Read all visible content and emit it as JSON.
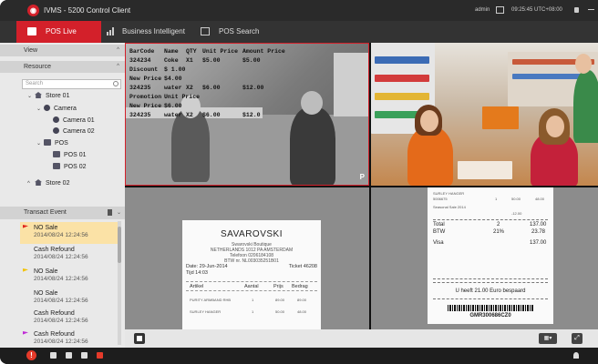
{
  "app": {
    "title": "IVMS - 5200 Control Client",
    "user": "admin",
    "clock": "09:25:45 UTC+08:00"
  },
  "tabs": [
    {
      "label": "POS Live",
      "icon": "pos-icon",
      "active": true
    },
    {
      "label": "Business Intelligent",
      "icon": "bar-chart-icon",
      "active": false
    },
    {
      "label": "POS Search",
      "icon": "pos-search-icon",
      "active": false
    }
  ],
  "sidebar": {
    "view_label": "View",
    "resource_label": "Resource",
    "search_placeholder": "Search",
    "tree": [
      {
        "label": "Store 01",
        "icon": "house-icon",
        "chev": "⌄"
      },
      {
        "label": "Camera",
        "icon": "camera-group-icon",
        "chev": "⌄"
      },
      {
        "label": "Camera 01",
        "icon": "camera-icon",
        "chev": ""
      },
      {
        "label": "Camera 02",
        "icon": "camera-icon",
        "chev": ""
      },
      {
        "label": "POS",
        "icon": "pos-group-icon",
        "chev": "⌄"
      },
      {
        "label": "POS 01",
        "icon": "pos-icon",
        "chev": ""
      },
      {
        "label": "POS 02",
        "icon": "pos-icon",
        "chev": ""
      },
      {
        "label": "Store 02",
        "icon": "house-icon",
        "chev": "^"
      }
    ],
    "events_label": "Transact Event",
    "events": [
      {
        "name": "NO Sale",
        "time": "2014/08/24 12:24:56",
        "flag": "#e0251b",
        "selected": true
      },
      {
        "name": "Cash Refound",
        "time": "2014/08/24 12:24:56",
        "flag": "",
        "selected": false
      },
      {
        "name": "NO Sale",
        "time": "2014/08/24 12:24:56",
        "flag": "#f2c200",
        "selected": false
      },
      {
        "name": "NO Sale",
        "time": "2014/08/24 12:24:56",
        "flag": "",
        "selected": false
      },
      {
        "name": "Cash Refound",
        "time": "2014/08/24 12:24:56",
        "flag": "",
        "selected": false
      },
      {
        "name": "Cash Refound",
        "time": "2014/08/24 12:24:56",
        "flag": "#c02bd6",
        "selected": false
      }
    ]
  },
  "pos_overlay": [
    [
      "BarCode",
      "Name",
      "QTY",
      "Unit Price",
      "Amount Price"
    ],
    [
      "324234",
      "Coke",
      "X1",
      "$5.00",
      "$5.00"
    ],
    [
      "Discount",
      "$ 1.00",
      "",
      "",
      ""
    ],
    [
      "New Price",
      "$4.00",
      "",
      "",
      ""
    ],
    [
      "324235",
      "water",
      "X2",
      "$6.00",
      "$12.00"
    ],
    [
      "Promotion",
      "Unit Price",
      "",
      "",
      ""
    ],
    [
      "New Price",
      "$6.00",
      "",
      "",
      ""
    ],
    [
      "324235",
      "water",
      "X2",
      "$6.00",
      "$12.0"
    ]
  ],
  "pos_mark": "P",
  "receipt1": {
    "title": "SAVAROVSKI",
    "lines": [
      "Swarovski Boutique",
      "NETHERLANDS 1012 PA AMSTERDAM",
      "Telefoon 0206184108",
      "BTW nr. NL003035251B01"
    ],
    "date": "Date: 29-Jun-2014",
    "ticket": "Ticket 46208",
    "time": "Tijd 14:03",
    "headers": [
      "Artikel",
      "Aantal",
      "Prijs",
      "Bedrag"
    ],
    "items": [
      [
        "PURITY ARMBAND RHB",
        "1",
        "89.00",
        "89.00"
      ],
      [
        "SURLEY HANGER",
        "1",
        "50.00",
        "48.00"
      ]
    ]
  },
  "receipt2": {
    "item": "SURLEY HANGER",
    "item_code": "5006675",
    "item_qty": "1",
    "item_price": "50.00",
    "item_amount": "48.00",
    "discount_note": "Seasonal Sale 2014",
    "discount_value": "-12.00",
    "total": [
      "Total",
      "2",
      "137.00"
    ],
    "btw": [
      "BTW",
      "21%",
      "23.78"
    ],
    "visa": [
      "Visa",
      "",
      "137.00"
    ],
    "saved": "U heeft 21.00 Euro bespaard",
    "barcode": "GMR300686CZ0"
  },
  "controls": {
    "layout_label": "▦▾",
    "fullscreen_label": "⤢"
  },
  "colors": {
    "accent": "#d3202a",
    "selected_event": "#fbe2a6"
  }
}
